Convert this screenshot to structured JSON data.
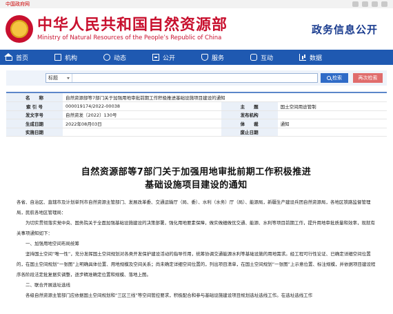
{
  "topbar": {
    "gov_link": "中国政府网"
  },
  "header": {
    "title_cn": "中华人民共和国自然资源部",
    "title_en": "Ministry of Natural Resources of the People’s Republic of China",
    "right_title": "政务信息公开"
  },
  "nav": {
    "items": [
      {
        "label": "首页",
        "icon": "home-icon"
      },
      {
        "label": "机构",
        "icon": "org-icon"
      },
      {
        "label": "动态",
        "icon": "news-icon"
      },
      {
        "label": "公开",
        "icon": "open-icon"
      },
      {
        "label": "服务",
        "icon": "service-icon"
      },
      {
        "label": "互动",
        "icon": "interaction-icon"
      },
      {
        "label": "数据",
        "icon": "data-icon"
      }
    ]
  },
  "search": {
    "scope": "标题",
    "placeholder": "",
    "search_label": "检索",
    "refine_label": "再次检索"
  },
  "meta": {
    "rows": [
      {
        "k1": "名　　称",
        "v1": "自然资源部等7部门关于加强用地审批前期工作积极推进基础设施项目建设的通知",
        "k2": "",
        "v2": ""
      },
      {
        "k1": "索 引 号",
        "v1": "000019174/2022-00038",
        "k2": "主　　题",
        "v2": "国土空间用途管制"
      },
      {
        "k1": "发文字号",
        "v1": "自然资发〔2022〕130号",
        "k2": "发布机构",
        "v2": ""
      },
      {
        "k1": "生成日期",
        "v1": "2022年08月03日",
        "k2": "体　　裁",
        "v2": "通知"
      },
      {
        "k1": "实施日期",
        "v1": "",
        "k2": "废止日期",
        "v2": ""
      }
    ]
  },
  "article": {
    "title_line1": "自然资源部等7部门关于加强用地审批前期工作积极推进",
    "title_line2": "基础设施项目建设的通知",
    "para1": "各省、自治区、直辖市及计划单列市自然资源主管部门、发展改革委、交通运输厅（局、委）、水利（水务）厅（局）、能源局，新疆生产建设兵团自然资源局，各地区铁路监督管理局，民航各地区管理局：",
    "para2": "为切实贯彻落实党中央、国务院关于全面加强基础设施建设的决策部署，强化用地要素保障，做实做细做优交通、能源、水利等项目前期工作，提升用地审批质量和效率，现就有关事项通知如下：",
    "section1": "一、加强用地空间布局统筹",
    "para3": "坚持国土空间“唯一性”，充分发挥国土空间规划对各类开发保护建设活动的指导作用，统筹协调交通能源水利等基础设施的用地需求。经工程可行性论证、已确定详细空间位置的，在国土空间规划“一张图”上明确具体位置、用地规模及空间关系；尚未确定详细空间位置的，列出项目清单，在国土空间规划“一张图”上示意位置、标注规模，并依据项目建设程序各阶段法定批复据实调整，逐步精准确定位置和规模、落地上图。",
    "section2": "二、联合开展选址选线",
    "para4": "各级自然资源主管部门应依据国土空间规划和“三区三线”等空间管控要求，积极配合和参与基础设施建设项目规划选址选线工作。在选址选线工作"
  }
}
